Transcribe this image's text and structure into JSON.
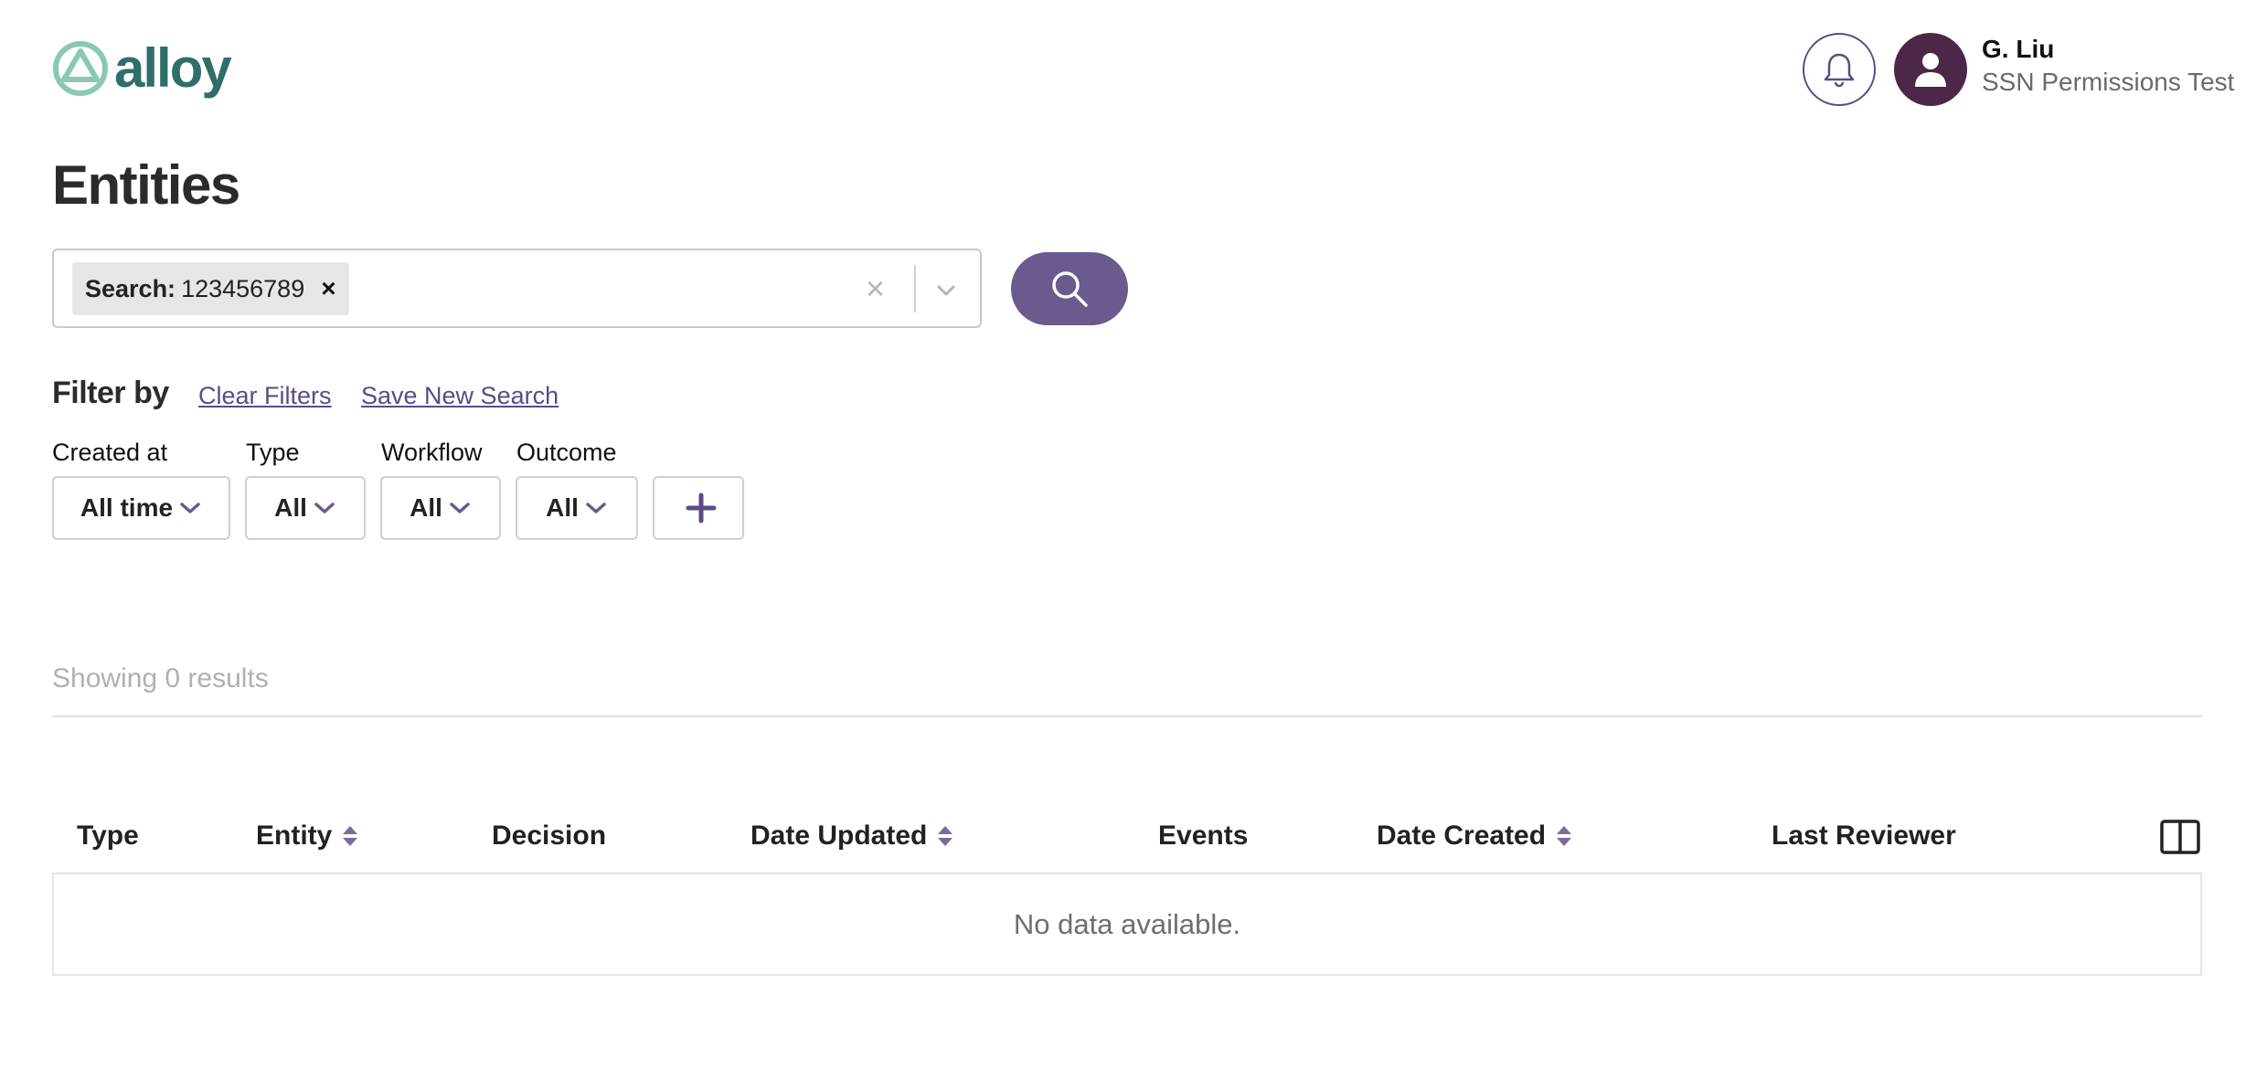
{
  "brand": {
    "name": "alloy",
    "color": "#2f6e6a",
    "accent": "#6a5a8e"
  },
  "header": {
    "notifications_icon": "bell-icon",
    "user": {
      "avatar_icon": "user-icon",
      "name": "G. Liu",
      "org": "SSN Permissions Test"
    }
  },
  "page": {
    "title": "Entities"
  },
  "search": {
    "chip": {
      "key": "Search:",
      "value": "123456789",
      "remove": "×"
    },
    "clear": "×",
    "button_icon": "search-icon"
  },
  "filters": {
    "heading": "Filter by",
    "clear_link": "Clear Filters",
    "save_link": "Save New Search",
    "items": [
      {
        "label": "Created at",
        "value": "All time"
      },
      {
        "label": "Type",
        "value": "All"
      },
      {
        "label": "Workflow",
        "value": "All"
      },
      {
        "label": "Outcome",
        "value": "All"
      }
    ],
    "add_icon": "plus-icon"
  },
  "results": {
    "text": "Showing 0 results"
  },
  "table": {
    "columns": [
      {
        "label": "Type",
        "sortable": false
      },
      {
        "label": "Entity",
        "sortable": true
      },
      {
        "label": "Decision",
        "sortable": false
      },
      {
        "label": "Date Updated",
        "sortable": true
      },
      {
        "label": "Events",
        "sortable": false
      },
      {
        "label": "Date Created",
        "sortable": true
      },
      {
        "label": "Last Reviewer",
        "sortable": false
      }
    ],
    "columns_toggle_icon": "columns-icon",
    "empty_message": "No data available."
  }
}
